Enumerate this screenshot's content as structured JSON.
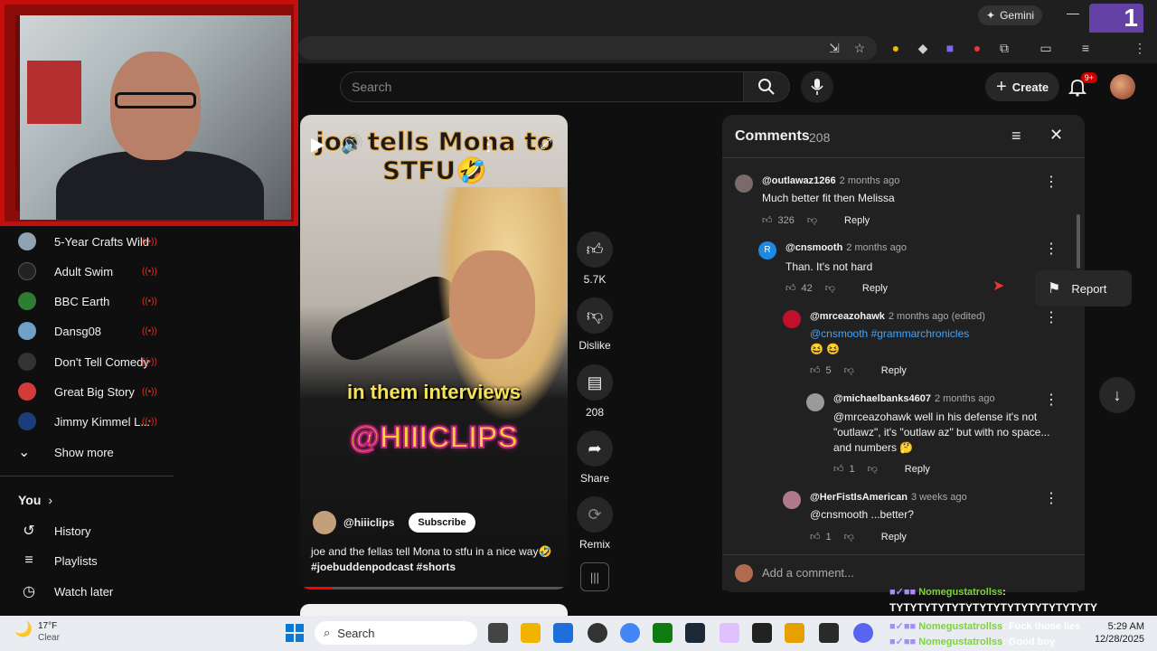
{
  "browser": {
    "gemini_label": "Gemini"
  },
  "header": {
    "search_placeholder": "Search",
    "create_label": "Create",
    "notification_count": "9+"
  },
  "sidebar": {
    "subscriptions": [
      {
        "label": "5-Year Crafts Wild",
        "color": "#8fa3b2"
      },
      {
        "label": "Adult Swim",
        "color": "#222222"
      },
      {
        "label": "BBC Earth",
        "color": "#2e7d32"
      },
      {
        "label": "Dansg08",
        "color": "#6fa0c8"
      },
      {
        "label": "Don't Tell Comedy",
        "color": "#333333"
      },
      {
        "label": "Great Big Story",
        "color": "#d33b3b"
      },
      {
        "label": "Jimmy Kimmel L...",
        "color": "#1c3d7a"
      }
    ],
    "show_more": "Show more",
    "you_label": "You",
    "you_items": [
      {
        "label": "History",
        "icon": "history-icon"
      },
      {
        "label": "Playlists",
        "icon": "playlists-icon"
      },
      {
        "label": "Watch later",
        "icon": "watch-later-icon"
      }
    ]
  },
  "video": {
    "title_overlay": "joe tells Mona to STFU🤣",
    "overlay_text_1": "in them interviews",
    "overlay_text_2": "@HIIICLIPS",
    "channel": "@hiiiclips",
    "subscribe_label": "Subscribe",
    "description": "joe and the fellas tell Mona to stfu in a nice way🤣",
    "hashtags": "#joebuddenpodcast #shorts",
    "progress": 0.12
  },
  "actions": {
    "likes": "5.7K",
    "dislike": "Dislike",
    "comments": "208",
    "share": "Share",
    "remix": "Remix"
  },
  "comments": {
    "title": "Comments",
    "count": "208",
    "add_placeholder": "Add a comment...",
    "report_label": "Report",
    "items": [
      {
        "author": "@outlawaz1266",
        "time": "2 months ago",
        "text": "Much better fit then Melissa",
        "likes": "326",
        "reply": "Reply",
        "color": "#7a6a6a"
      },
      {
        "author": "@cnsmooth",
        "time": "2 months ago",
        "text": "Than. It's not hard",
        "likes": "42",
        "reply": "Reply",
        "avatar_letter": "R",
        "color": "#1e88e5"
      },
      {
        "author": "@mrceazohawk",
        "time": "2 months ago (edited)",
        "mention1": "@cnsmooth",
        "mention2": "#grammarchronicles",
        "text2": "😆 😆",
        "likes": "5",
        "reply": "Reply",
        "color": "#c0102a"
      },
      {
        "author": "@michaelbanks4607",
        "time": "2 months ago",
        "line1": "@mrceazohawk well in his defense it's not",
        "line2": "\"outlawz\", it's \"outlaw az\"  but with no space...",
        "line3": "and numbers 🤔",
        "likes": "1",
        "reply": "Reply",
        "color": "#9a9a9a"
      },
      {
        "author": "@HerFistIsAmerican",
        "time": "3 weeks ago",
        "text": "@cnsmooth  ...better?",
        "likes": "1",
        "reply": "Reply",
        "color": "#b07a8a"
      }
    ]
  },
  "chat": [
    {
      "user": "Nomegustatrollss",
      "sep": ":",
      "msg": ""
    },
    {
      "user": "",
      "sep": "",
      "msg": "TYTYTYTYTYTYTYTYTYTYTYTYTYTYTY"
    },
    {
      "user": "Nomegustatrollss",
      "sep": ":",
      "msg": "Fuck those lies"
    },
    {
      "user": "Nomegustatrollss",
      "sep": ":",
      "msg": "Good boy"
    }
  ],
  "taskbar": {
    "weather_temp": "17°F",
    "weather_desc": "Clear",
    "search_label": "Search",
    "time": "5:29 AM",
    "date": "12/28/2025"
  }
}
